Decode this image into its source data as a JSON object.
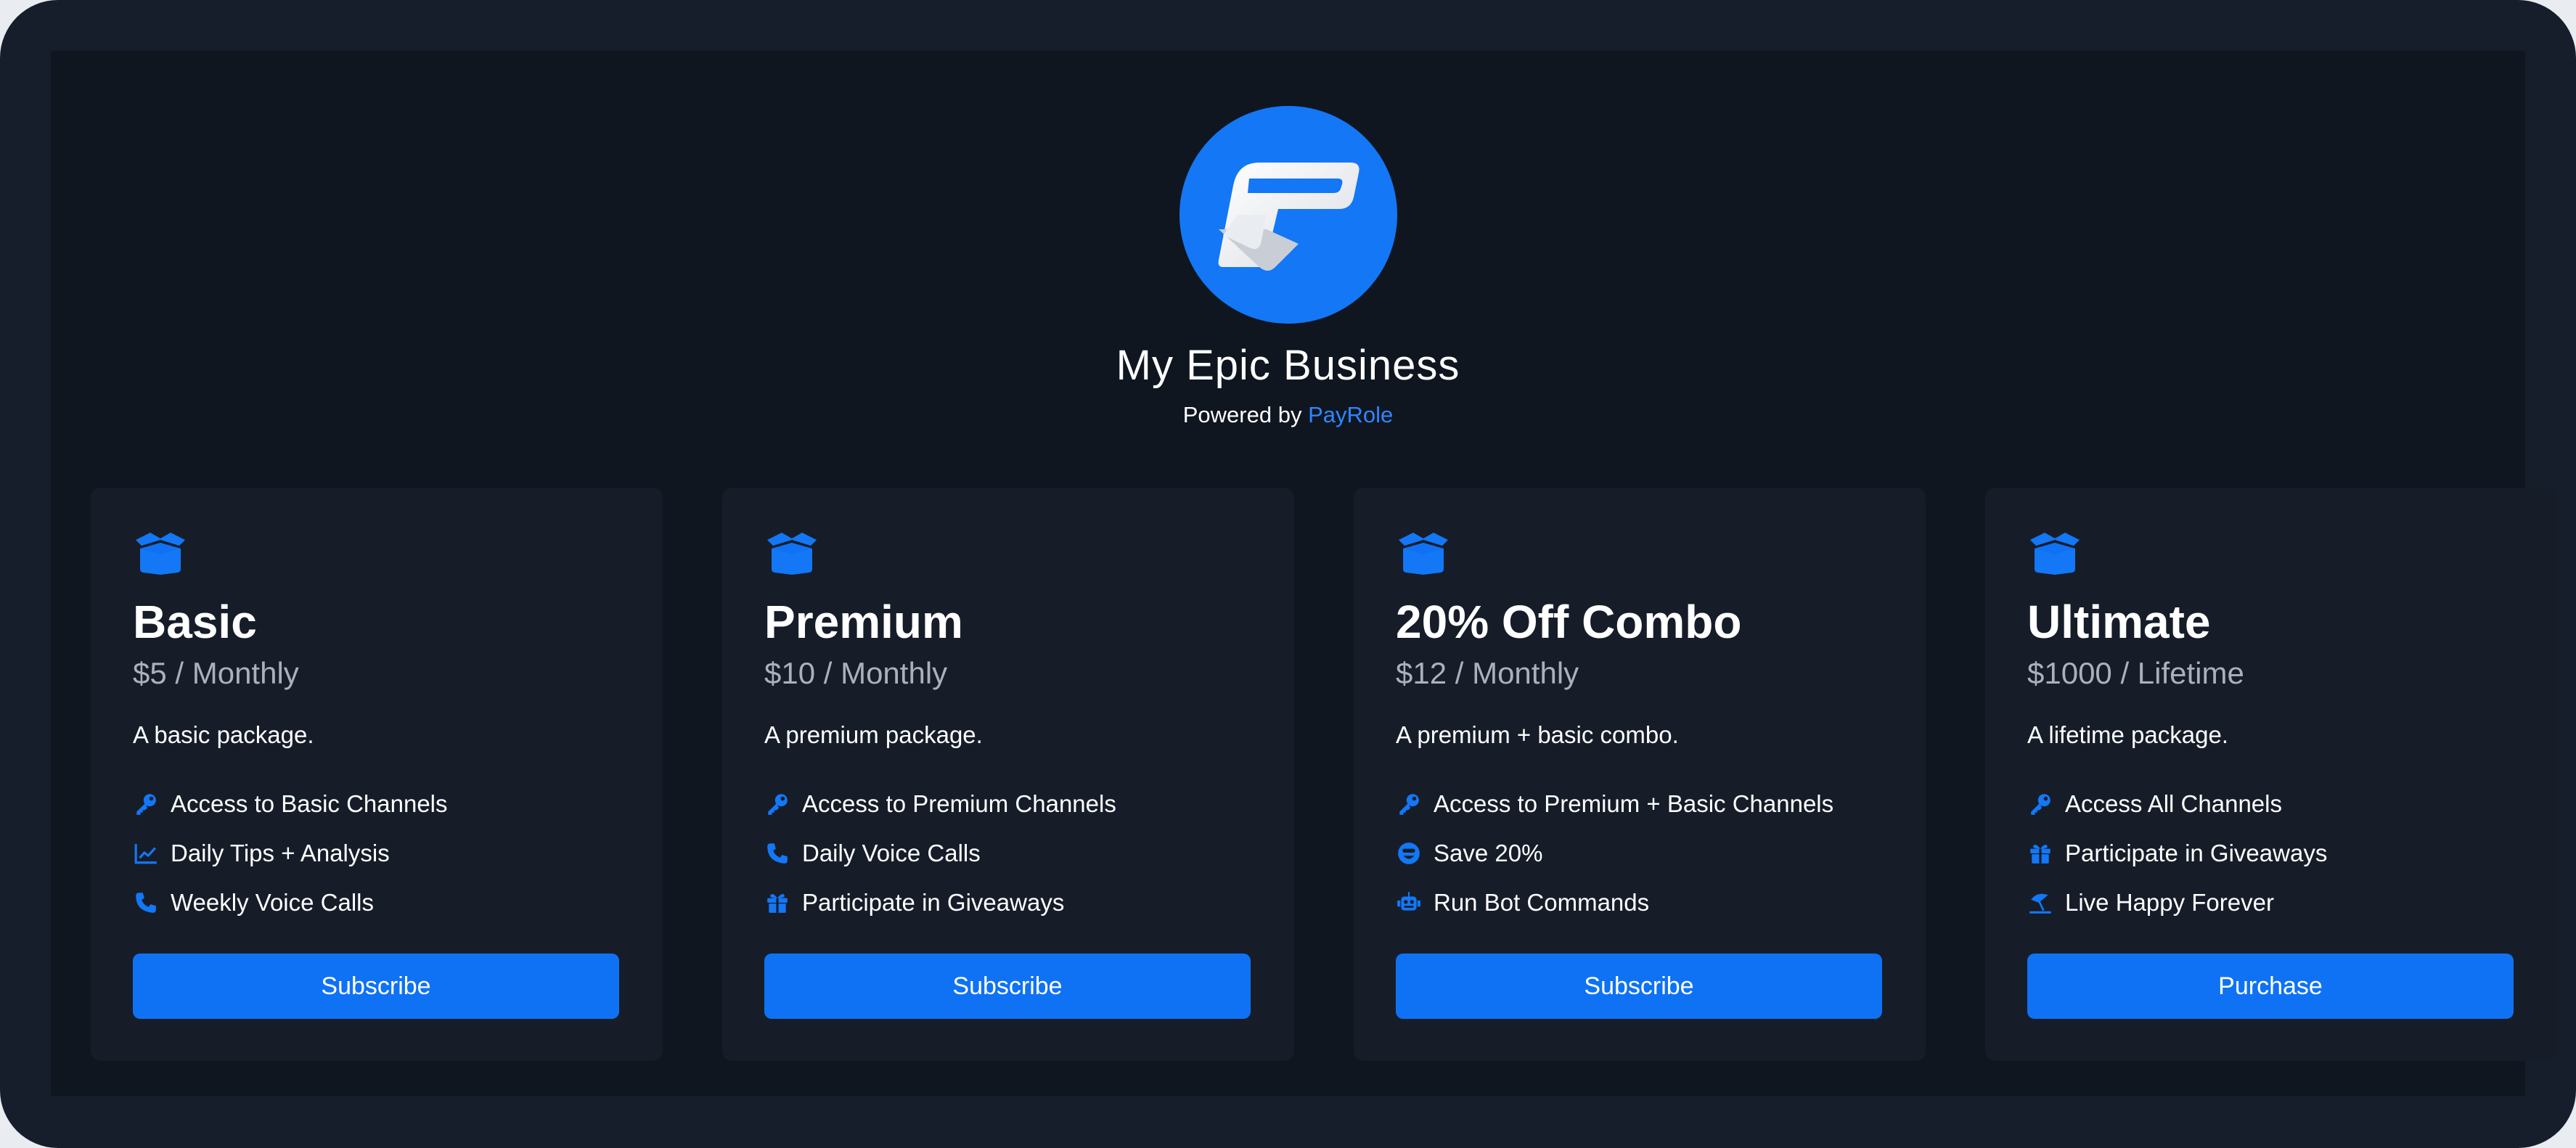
{
  "business": {
    "name": "My Epic Business",
    "powered_prefix": "Powered by",
    "powered_brand": "PayRole"
  },
  "colors": {
    "accent": "#0f72f4",
    "brand_link": "#2f86ff",
    "card_bg": "#161d29",
    "page_bg": "#0f1620"
  },
  "plans": [
    {
      "title": "Basic",
      "price": "$5 / Monthly",
      "description": "A basic package.",
      "icon": "box-open-icon",
      "features": [
        {
          "icon": "key-icon",
          "label": "Access to Basic Channels"
        },
        {
          "icon": "chart-line-icon",
          "label": "Daily Tips + Analysis"
        },
        {
          "icon": "phone-icon",
          "label": "Weekly Voice Calls"
        }
      ],
      "cta": "Subscribe"
    },
    {
      "title": "Premium",
      "price": "$10 / Monthly",
      "description": "A premium package.",
      "icon": "box-open-icon",
      "features": [
        {
          "icon": "key-icon",
          "label": "Access to Premium Channels"
        },
        {
          "icon": "phone-icon",
          "label": "Daily Voice Calls"
        },
        {
          "icon": "gift-icon",
          "label": "Participate in Giveaways"
        }
      ],
      "cta": "Subscribe"
    },
    {
      "title": "20% Off Combo",
      "price": "$12 / Monthly",
      "description": "A premium + basic combo.",
      "icon": "box-open-icon",
      "features": [
        {
          "icon": "key-icon",
          "label": "Access to Premium + Basic Channels"
        },
        {
          "icon": "smile-icon",
          "label": "Save 20%"
        },
        {
          "icon": "robot-icon",
          "label": "Run Bot Commands"
        }
      ],
      "cta": "Subscribe"
    },
    {
      "title": "Ultimate",
      "price": "$1000 / Lifetime",
      "description": "A lifetime package.",
      "icon": "box-open-icon",
      "features": [
        {
          "icon": "key-icon",
          "label": "Access All Channels"
        },
        {
          "icon": "gift-icon",
          "label": "Participate in Giveaways"
        },
        {
          "icon": "umbrella-beach-icon",
          "label": "Live Happy Forever"
        }
      ],
      "cta": "Purchase"
    }
  ]
}
